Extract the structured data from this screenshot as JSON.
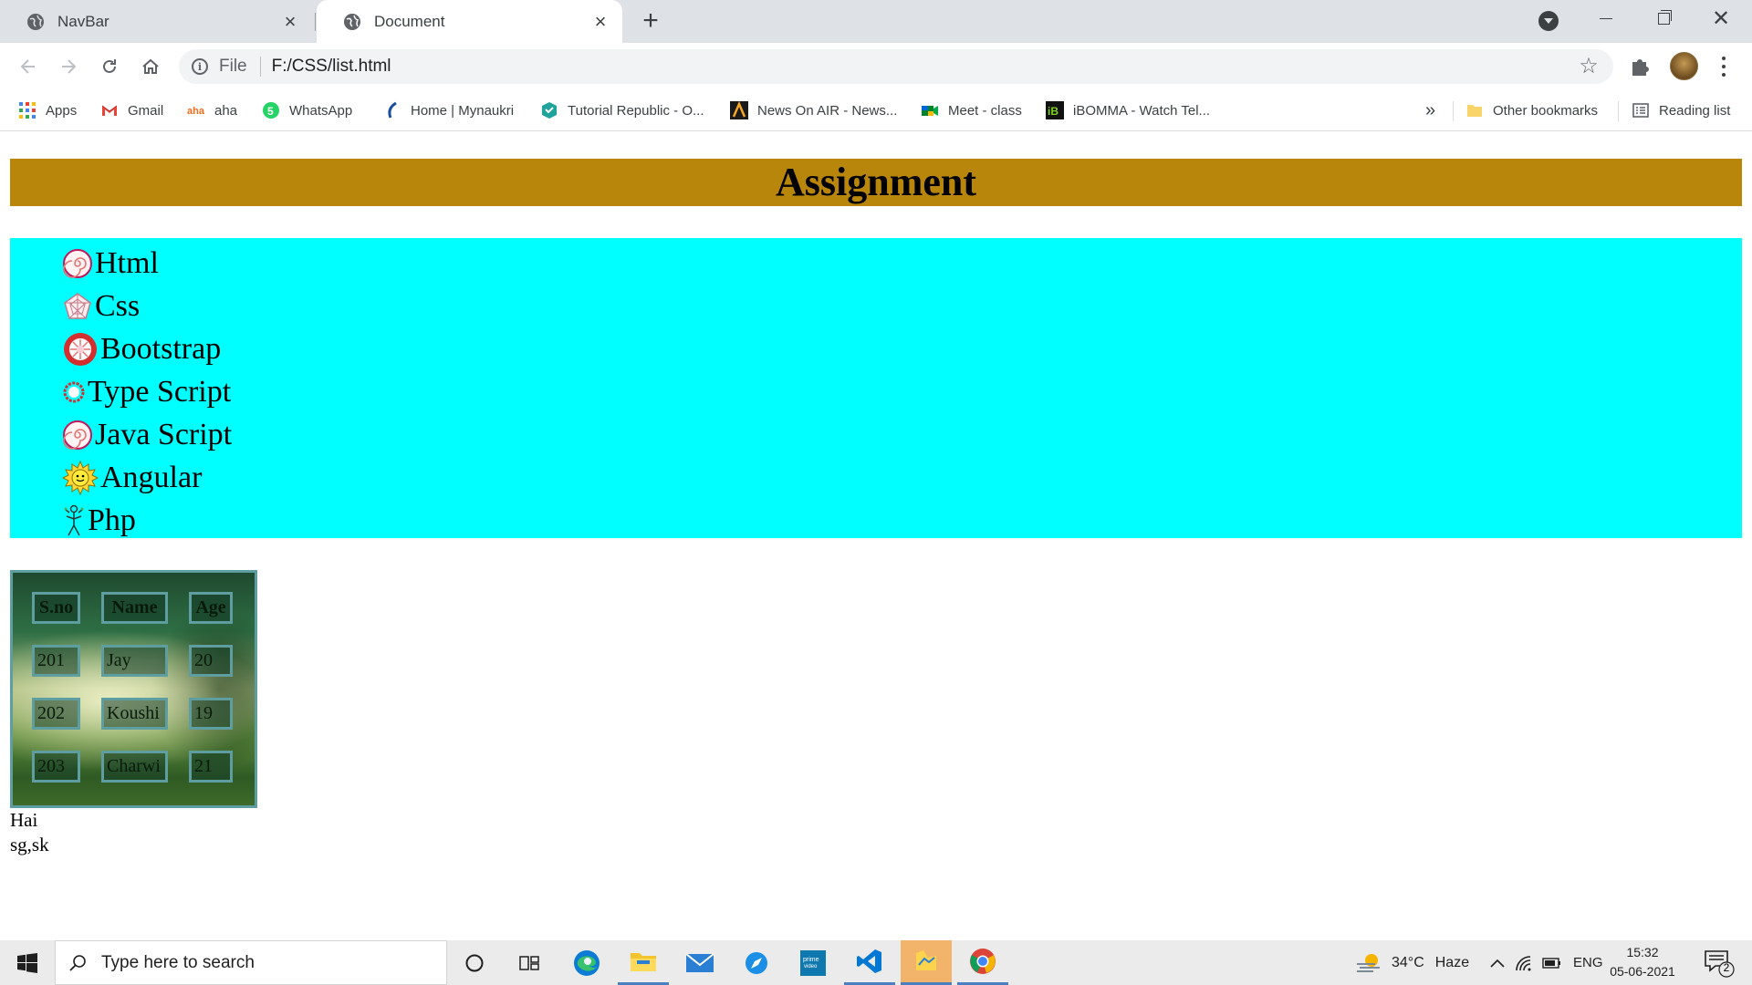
{
  "browser": {
    "tabs": [
      {
        "label": "NavBar",
        "active": false
      },
      {
        "label": "Document",
        "active": true
      }
    ],
    "omnibox": {
      "scheme_label": "File",
      "url": "F:/CSS/list.html"
    },
    "bookmarks": [
      {
        "label": "Apps",
        "icon": "apps-grid-icon"
      },
      {
        "label": "Gmail",
        "icon": "gmail-icon"
      },
      {
        "label": "aha",
        "icon": "aha-icon"
      },
      {
        "label": "WhatsApp",
        "icon": "whatsapp-icon"
      },
      {
        "label": "Home | Mynaukri",
        "icon": "mynaukri-icon"
      },
      {
        "label": "Tutorial Republic - O...",
        "icon": "tutorial-republic-icon"
      },
      {
        "label": "News On AIR - News...",
        "icon": "news-on-air-icon"
      },
      {
        "label": "Meet - class",
        "icon": "google-meet-icon"
      },
      {
        "label": "iBOMMA - Watch Tel...",
        "icon": "ibomma-icon"
      }
    ],
    "bookmarks_overflow": "»",
    "other_bookmarks": "Other bookmarks",
    "reading_list": "Reading list"
  },
  "page": {
    "header": "Assignment",
    "topics": [
      {
        "label": "Html",
        "icon": "red-spiral-circle-icon"
      },
      {
        "label": "Css",
        "icon": "pentagon-web-icon"
      },
      {
        "label": " Bootstrap",
        "icon": "red-flower-badge-icon"
      },
      {
        "label": "Type Script",
        "icon": "red-cog-ring-icon"
      },
      {
        "label": "Java Script",
        "icon": "red-spiral-circle-icon"
      },
      {
        "label": "Angular",
        "icon": "yellow-sun-icon"
      },
      {
        "label": "Php",
        "icon": "stick-figure-icon"
      }
    ],
    "table": {
      "headers": [
        "S.no",
        "Name",
        "Age"
      ],
      "rows": [
        [
          "201",
          "Jay",
          "20"
        ],
        [
          "202",
          "Koushi",
          "19"
        ],
        [
          "203",
          "Charwi",
          "21"
        ]
      ]
    },
    "footer_lines": [
      "Hai",
      "sg,sk"
    ]
  },
  "taskbar": {
    "search_placeholder": "Type here to search",
    "weather": {
      "temp": "34°C",
      "condition": "Haze"
    },
    "language": "ENG",
    "time": "15:32",
    "date": "05-06-2021",
    "notification_count": "2"
  },
  "colors": {
    "header_bg": "#b8860b",
    "list_bg": "#00ffff",
    "table_border": "#5f9ea0",
    "tabstrip_bg": "#dee1e6"
  }
}
